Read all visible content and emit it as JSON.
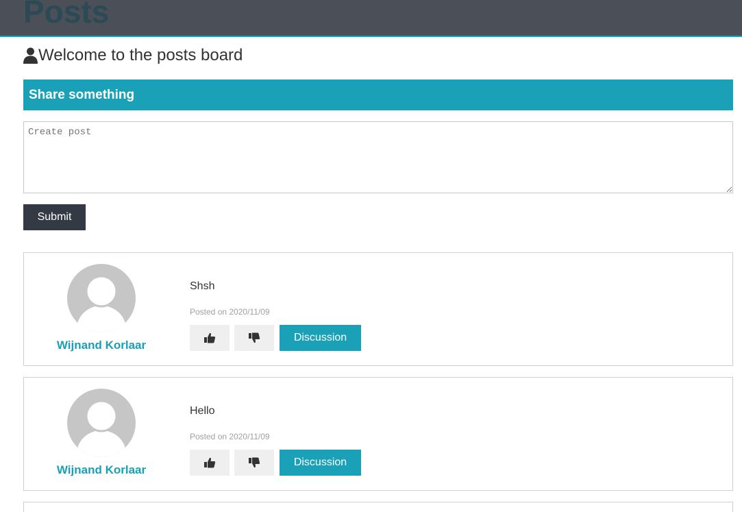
{
  "header": {
    "title": "Posts"
  },
  "welcome": {
    "text": "Welcome to the posts board",
    "icon": "user-icon"
  },
  "share": {
    "heading": "Share something",
    "placeholder": "Create post",
    "submit_label": "Submit"
  },
  "colors": {
    "accent": "#1aa1b8",
    "topbar": "#4a4f58",
    "submit": "#343a43",
    "vote_button": "#efefef"
  },
  "posts": [
    {
      "author": "Wijnand Korlaar",
      "body": "Shsh",
      "date": "Posted on 2020/11/09",
      "like_icon": "thumbs-up-icon",
      "dislike_icon": "thumbs-down-icon",
      "discussion_label": "Discussion"
    },
    {
      "author": "Wijnand Korlaar",
      "body": "Hello",
      "date": "Posted on 2020/11/09",
      "like_icon": "thumbs-up-icon",
      "dislike_icon": "thumbs-down-icon",
      "discussion_label": "Discussion"
    }
  ]
}
